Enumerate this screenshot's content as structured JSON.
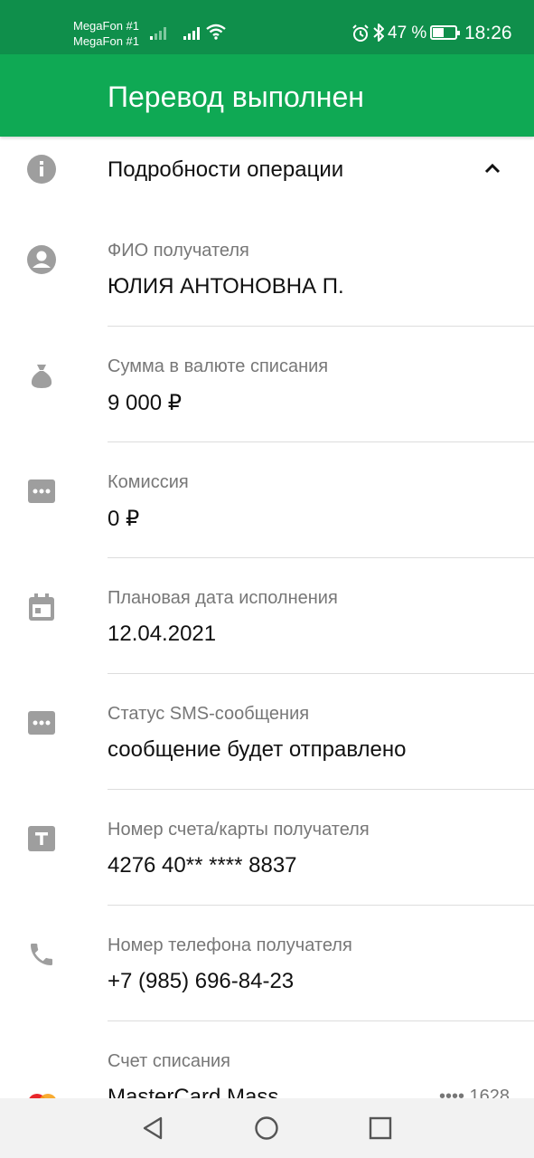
{
  "status_bar": {
    "carrier_1": "MegaFon #1",
    "carrier_2": "MegaFon #1",
    "battery_percent": "47 %",
    "time": "18:26"
  },
  "app_bar": {
    "title": "Перевод выполнен"
  },
  "details": {
    "title": "Подробности операции",
    "rows": [
      {
        "label": "ФИО получателя",
        "value": "ЮЛИЯ АНТОНОВНА П.",
        "icon": "person-icon"
      },
      {
        "label": "Сумма в валюте списания",
        "value": "9 000 ₽",
        "icon": "money-bag-icon"
      },
      {
        "label": "Комиссия",
        "value": "0 ₽",
        "icon": "more-dots-icon"
      },
      {
        "label": "Плановая дата исполнения",
        "value": "12.04.2021",
        "icon": "calendar-icon"
      },
      {
        "label": "Статус SMS-сообщения",
        "value": "сообщение будет отправлено",
        "icon": "more-dots-icon"
      },
      {
        "label": "Номер счета/карты получателя",
        "value": "4276 40** **** 8837",
        "icon": "card-number-icon"
      },
      {
        "label": "Номер телефона получателя",
        "value": "+7 (985) 696-84-23",
        "icon": "phone-icon"
      },
      {
        "label": "Счет списания",
        "value": "MasterCard Mass",
        "extra": "•••• 1628",
        "icon": "mastercard-icon"
      }
    ]
  },
  "colors": {
    "status_bar": "#0f8f4b",
    "app_bar": "#0fa954",
    "icon_gray": "#9e9e9e"
  }
}
